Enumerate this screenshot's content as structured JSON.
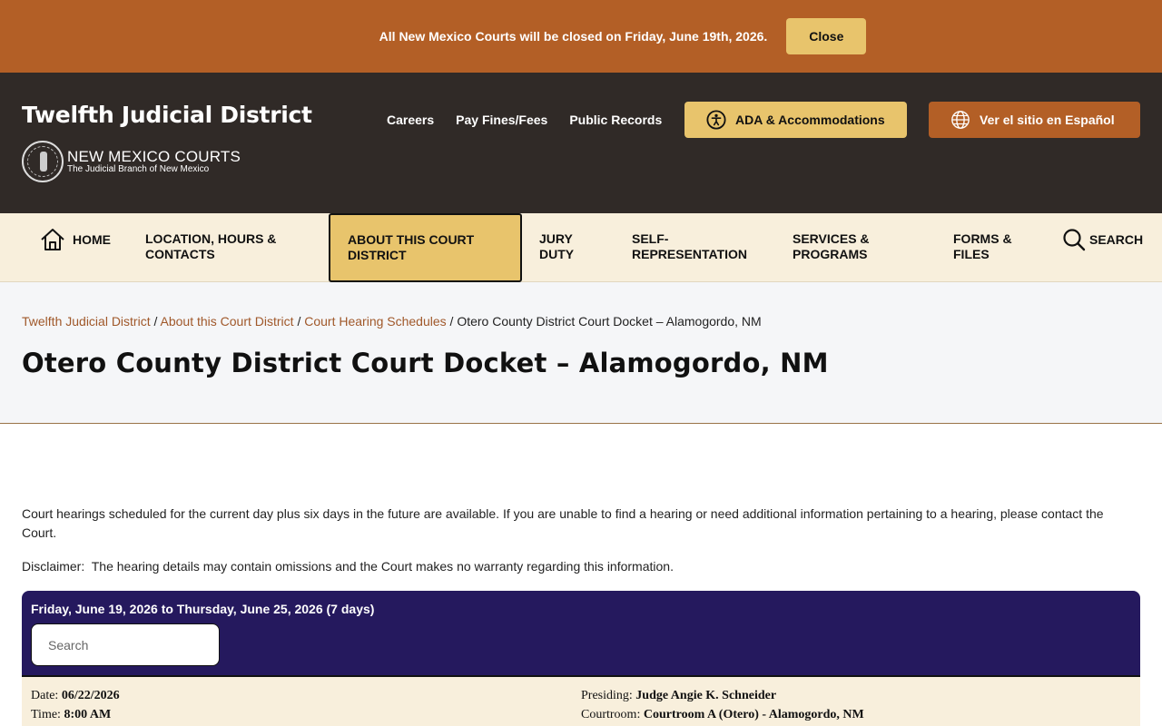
{
  "alert": {
    "message": "All New Mexico Courts will be closed on Friday, June 19th, 2026.",
    "close_label": "Close"
  },
  "header": {
    "site_title": "Twelfth Judicial District",
    "brand_name": "NEW MEXICO COURTS",
    "brand_tagline": "The Judicial Branch of New Mexico",
    "links": [
      "Careers",
      "Pay Fines/Fees",
      "Public Records"
    ],
    "ada_label": "ADA & Accommodations",
    "spanish_label": "Ver el sitio en Español"
  },
  "nav": {
    "home": "HOME",
    "location": "LOCATION, HOURS & CONTACTS",
    "about": "ABOUT THIS COURT DISTRICT",
    "jury": "JURY DUTY",
    "self_rep": "SELF-REPRESENTATION",
    "services": "SERVICES & PROGRAMS",
    "forms": "FORMS & FILES",
    "search": "SEARCH"
  },
  "breadcrumb": {
    "items": [
      "Twelfth Judicial District",
      "About this Court District",
      "Court Hearing Schedules"
    ],
    "separator": " / ",
    "current": "Otero County District Court Docket – Alamogordo, NM"
  },
  "page": {
    "title": "Otero County District Court Docket – Alamogordo, NM",
    "intro": "Court hearings scheduled for the current day plus six days in the future are available. If you are unable to find a hearing or need additional information pertaining to a hearing, please contact the Court.",
    "disclaimer": "Disclaimer:  The hearing details may contain omissions and the Court makes no warranty regarding this information."
  },
  "docket": {
    "range": "Friday, June 19, 2026 to Thursday, June 25, 2026 (7 days)",
    "search_placeholder": "Search",
    "entry": {
      "date_label": "Date:",
      "date": "06/22/2026",
      "time_label": "Time:",
      "time": "8:00 AM",
      "presiding_label": "Presiding:",
      "presiding": "Judge Angie K. Schneider",
      "courtroom_label": "Courtroom:",
      "courtroom": "Courtroom A (Otero) - Alamogordo, NM"
    }
  },
  "colors": {
    "alert_bg": "#b35f26",
    "header_bg": "#302a27",
    "accent_gold": "#e8c46c",
    "nav_bg": "#f8efdc",
    "docket_bg": "#25195e",
    "link": "#a0582a"
  },
  "icons": {
    "ada": "accessibility-icon",
    "spanish": "globe-icon",
    "home": "home-icon",
    "search": "search-icon",
    "seal": "court-seal-icon"
  }
}
